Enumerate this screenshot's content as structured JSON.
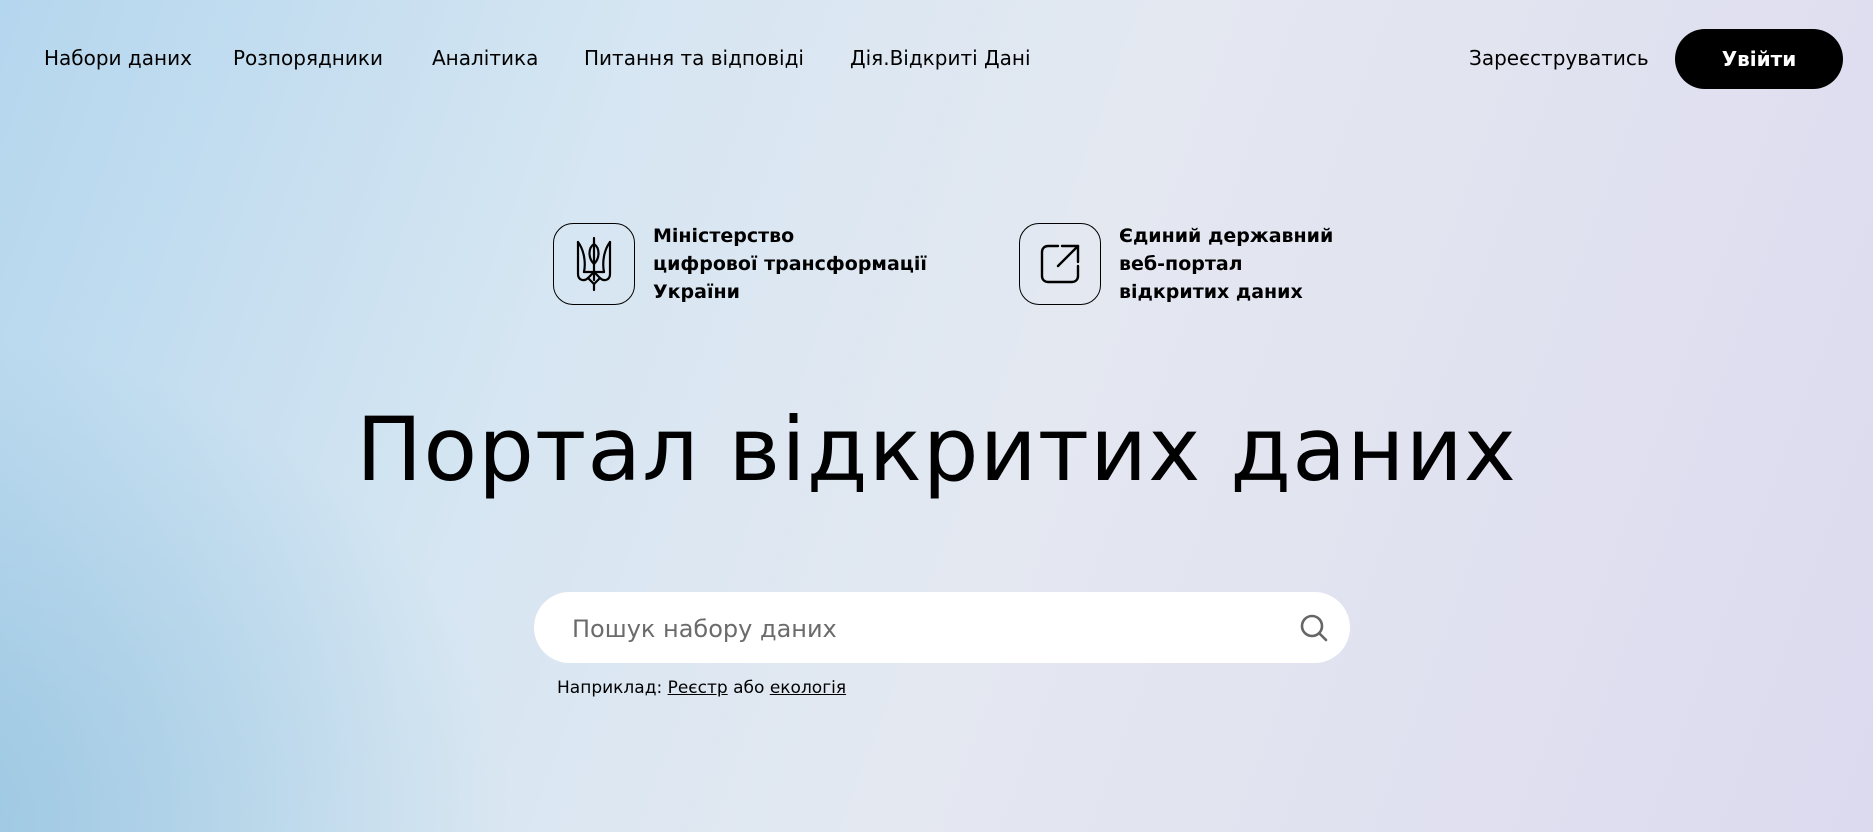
{
  "nav": {
    "items": [
      {
        "label": "Набори даних"
      },
      {
        "label": "Розпорядники"
      },
      {
        "label": "Аналітика"
      },
      {
        "label": "Питання та відповіді"
      },
      {
        "label": "Дія.Відкриті Дані"
      }
    ],
    "register_label": "Зареєструватись",
    "login_label": "Увійти"
  },
  "partners": {
    "ministry": {
      "icon": "trident-coat-of-arms-icon",
      "lines": [
        "Міністерство",
        "цифрової трансформації",
        "України"
      ]
    },
    "portal": {
      "icon": "external-link-icon",
      "lines": [
        "Єдиний державний",
        "веб-портал",
        "відкритих даних"
      ]
    }
  },
  "hero": {
    "title": "Портал відкритих даних"
  },
  "search": {
    "placeholder": "Пошук набору даних",
    "value": "",
    "icon": "search-icon"
  },
  "examples": {
    "prefix": "Наприклад:",
    "link1": "Реєстр",
    "separator": "або",
    "link2": "екологія"
  },
  "colors": {
    "primary": "#000000",
    "button_text": "#ffffff",
    "search_bg": "#ffffff",
    "bg_left": "#a9cde6",
    "bg_right": "#dcdaef"
  }
}
